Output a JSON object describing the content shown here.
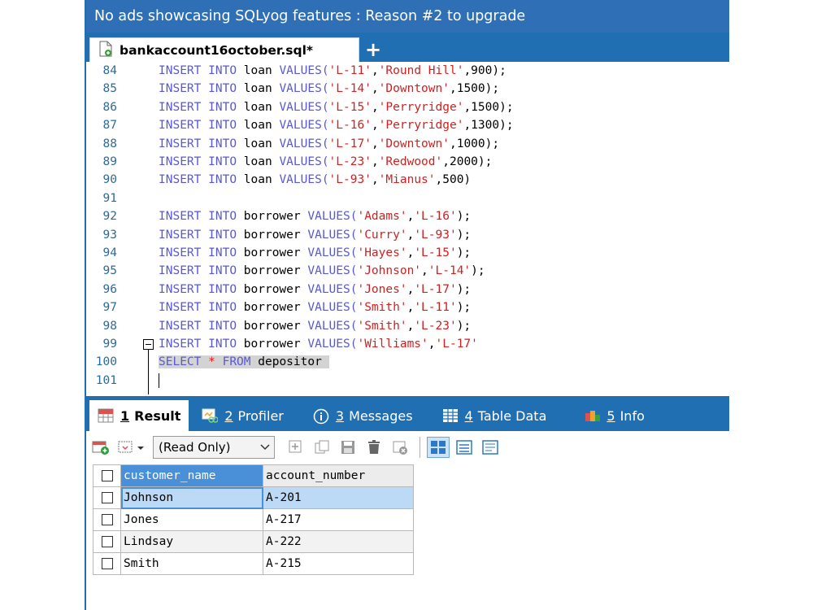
{
  "ad_banner": "No ads showcasing SQLyog features : Reason #2 to upgrade",
  "file_tab": {
    "title": "bankaccount16october.sql*",
    "add_label": "+"
  },
  "editor_lines": [
    {
      "n": "84",
      "table": "loan",
      "args": [
        [
          "'L-11'",
          "str"
        ],
        [
          ",",
          "p"
        ],
        [
          "'Round Hill'",
          "str"
        ],
        [
          ",900);",
          "p"
        ]
      ]
    },
    {
      "n": "85",
      "table": "loan",
      "args": [
        [
          "'L-14'",
          "str"
        ],
        [
          ",",
          "p"
        ],
        [
          "'Downtown'",
          "str"
        ],
        [
          ",1500);",
          "p"
        ]
      ]
    },
    {
      "n": "86",
      "table": "loan",
      "args": [
        [
          "'L-15'",
          "str"
        ],
        [
          ",",
          "p"
        ],
        [
          "'Perryridge'",
          "str"
        ],
        [
          ",1500);",
          "p"
        ]
      ]
    },
    {
      "n": "87",
      "table": "loan",
      "args": [
        [
          "'L-16'",
          "str"
        ],
        [
          ",",
          "p"
        ],
        [
          "'Perryridge'",
          "str"
        ],
        [
          ",1300);",
          "p"
        ]
      ]
    },
    {
      "n": "88",
      "table": "loan",
      "args": [
        [
          "'L-17'",
          "str"
        ],
        [
          ",",
          "p"
        ],
        [
          "'Downtown'",
          "str"
        ],
        [
          ",1000);",
          "p"
        ]
      ]
    },
    {
      "n": "89",
      "table": "loan",
      "args": [
        [
          "'L-23'",
          "str"
        ],
        [
          ",",
          "p"
        ],
        [
          "'Redwood'",
          "str"
        ],
        [
          ",2000);",
          "p"
        ]
      ]
    },
    {
      "n": "90",
      "table": "loan",
      "args": [
        [
          "'L-93'",
          "str"
        ],
        [
          ",",
          "p"
        ],
        [
          "'Mianus'",
          "str"
        ],
        [
          ",500)",
          "p"
        ]
      ]
    },
    {
      "n": "91",
      "blank": true
    },
    {
      "n": "92",
      "table": "borrower",
      "args": [
        [
          "'Adams'",
          "str"
        ],
        [
          ",",
          "p"
        ],
        [
          "'L-16'",
          "str"
        ],
        [
          ");",
          "p"
        ]
      ]
    },
    {
      "n": "93",
      "table": "borrower",
      "args": [
        [
          "'Curry'",
          "str"
        ],
        [
          ",",
          "p"
        ],
        [
          "'L-93'",
          "str"
        ],
        [
          ");",
          "p"
        ]
      ]
    },
    {
      "n": "94",
      "table": "borrower",
      "args": [
        [
          "'Hayes'",
          "str"
        ],
        [
          ",",
          "p"
        ],
        [
          "'L-15'",
          "str"
        ],
        [
          ");",
          "p"
        ]
      ]
    },
    {
      "n": "95",
      "table": "borrower",
      "args": [
        [
          "'Johnson'",
          "str"
        ],
        [
          ",",
          "p"
        ],
        [
          "'L-14'",
          "str"
        ],
        [
          ");",
          "p"
        ]
      ]
    },
    {
      "n": "96",
      "table": "borrower",
      "args": [
        [
          "'Jones'",
          "str"
        ],
        [
          ",",
          "p"
        ],
        [
          "'L-17'",
          "str"
        ],
        [
          ");",
          "p"
        ]
      ]
    },
    {
      "n": "97",
      "table": "borrower",
      "args": [
        [
          "'Smith'",
          "str"
        ],
        [
          ",",
          "p"
        ],
        [
          "'L-11'",
          "str"
        ],
        [
          ");",
          "p"
        ]
      ]
    },
    {
      "n": "98",
      "table": "borrower",
      "args": [
        [
          "'Smith'",
          "str"
        ],
        [
          ",",
          "p"
        ],
        [
          "'L-23'",
          "str"
        ],
        [
          ");",
          "p"
        ]
      ]
    },
    {
      "n": "99",
      "table": "borrower",
      "args": [
        [
          "'Williams'",
          "str"
        ],
        [
          ",",
          "p"
        ],
        [
          "'L-17'",
          "str"
        ]
      ]
    },
    {
      "n": "100",
      "select": true
    },
    {
      "n": "101",
      "blank": true,
      "caret": true
    }
  ],
  "keywords": {
    "insert": "INSERT",
    "into": "INTO",
    "values": "VALUES(",
    "select": "SELECT",
    "star": "*",
    "from": "FROM"
  },
  "select_table": "depositor",
  "result_tabs": [
    {
      "num": "1",
      "label": "Result",
      "icon": "result-grid-icon",
      "active": true
    },
    {
      "num": "2",
      "label": "Profiler",
      "icon": "profiler-icon"
    },
    {
      "num": "3",
      "label": "Messages",
      "icon": "info-circle-icon"
    },
    {
      "num": "4",
      "label": "Table Data",
      "icon": "table-icon"
    },
    {
      "num": "5",
      "label": "Info",
      "icon": "info-blocks-icon"
    }
  ],
  "toolbar": {
    "readonly_value": "(Read Only)"
  },
  "grid": {
    "columns": [
      "customer_name",
      "account_number"
    ],
    "rows": [
      [
        "Johnson",
        "A-201"
      ],
      [
        "Jones",
        "A-217"
      ],
      [
        "Lindsay",
        "A-222"
      ],
      [
        "Smith",
        "A-215"
      ]
    ]
  },
  "colors": {
    "accent": "#1f6fb2",
    "banner": "#2e6fb6",
    "keyword": "#5858d6",
    "string": "#d21f1f"
  }
}
